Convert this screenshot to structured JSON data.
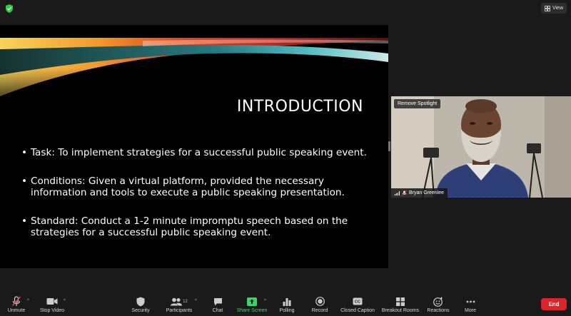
{
  "topbar": {
    "view_label": "View",
    "shield_color": "#2ecc40"
  },
  "slide": {
    "title": "INTRODUCTION",
    "bullets": [
      "Task: To implement strategies for a successful public speaking event.",
      "Conditions: Given a virtual platform, provided the necessary information and tools to execute a public speaking presentation.",
      "Standard: Conduct a 1-2 minute impromptu speech based on the strategies for a successful public speaking event."
    ]
  },
  "video": {
    "remove_spotlight_label": "Remove Spotlight",
    "participant_name": "Bryan Greenlee"
  },
  "toolbar": {
    "unmute": "Unmute",
    "stop_video": "Stop Video",
    "security": "Security",
    "participants": "Participants",
    "participants_count": "12",
    "chat": "Chat",
    "share_screen": "Share Screen",
    "polling": "Polling",
    "record": "Record",
    "closed_caption": "Closed Caption",
    "breakout_rooms": "Breakout Rooms",
    "reactions": "Reactions",
    "more": "More",
    "end": "End",
    "share_color": "#3dd36b",
    "end_color": "#d9252b",
    "mute_slash_color": "#e5484d"
  }
}
